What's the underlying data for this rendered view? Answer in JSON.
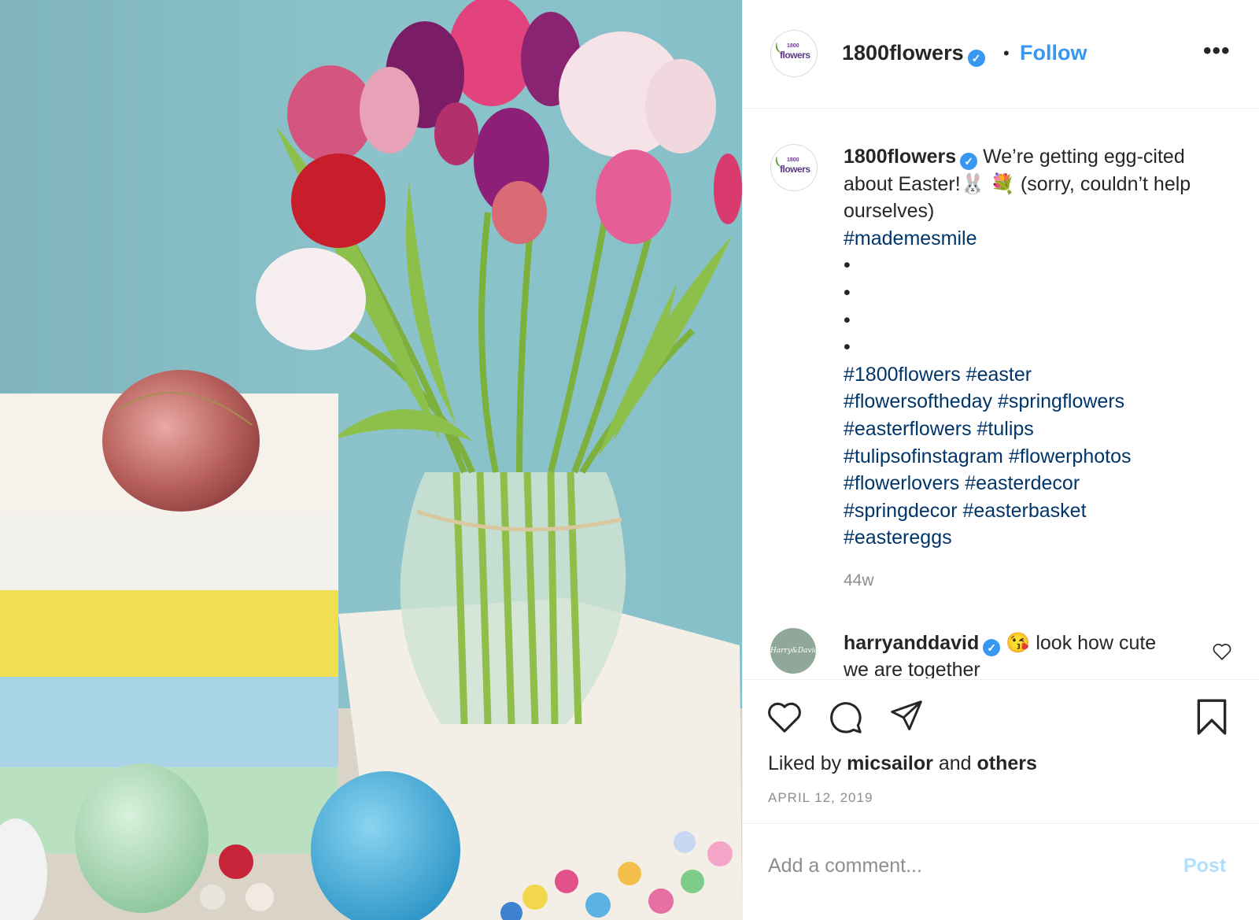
{
  "post": {
    "account": "1800flowers",
    "avatar_brand_top": "1800",
    "avatar_brand_word": "flowers",
    "follow_label": "Follow",
    "more_icon": "more-horizontal-icon",
    "image_alt": "Bouquet of pink, purple, red and white tulips in a glass vase next to an Easter box with a foil-wrapped egg and colorful plastic eggs"
  },
  "caption": {
    "username": "1800flowers",
    "text_part1": "We’re getting egg-cited about Easter!",
    "emoji_bunny": "🐰",
    "emoji_flowers": "💐",
    "text_part2": "(sorry, couldn’t help ourselves)",
    "tag_smile": "#mademesmile",
    "bullets": [
      "•",
      "•",
      "•",
      "•"
    ],
    "hashtags": [
      "#1800flowers",
      "#easter",
      "#flowersoftheday",
      "#springflowers",
      "#easterflowers",
      "#tulips",
      "#tulipsofinstagram",
      "#flowerphotos",
      "#flowerlovers",
      "#easterdecor",
      "#springdecor",
      "#easterbasket",
      "#eastereggs"
    ],
    "age": "44w"
  },
  "comment": {
    "username": "harryanddavid",
    "avatar_text": "Harry&David",
    "emoji": "😘",
    "text": "look how cute we are together"
  },
  "actions": {
    "icons": [
      "heart-icon",
      "comment-icon",
      "share-icon",
      "bookmark-icon"
    ],
    "liked_prefix": "Liked by",
    "liked_user": "micsailor",
    "liked_and": "and",
    "liked_others": "others",
    "date": "APRIL 12, 2019"
  },
  "comment_box": {
    "placeholder": "Add a comment...",
    "post_label": "Post"
  },
  "colors": {
    "link_blue": "#3897f0",
    "hashtag_navy": "#003569",
    "muted_gray": "#8e8e8e",
    "post_disabled": "#b2dffc"
  }
}
